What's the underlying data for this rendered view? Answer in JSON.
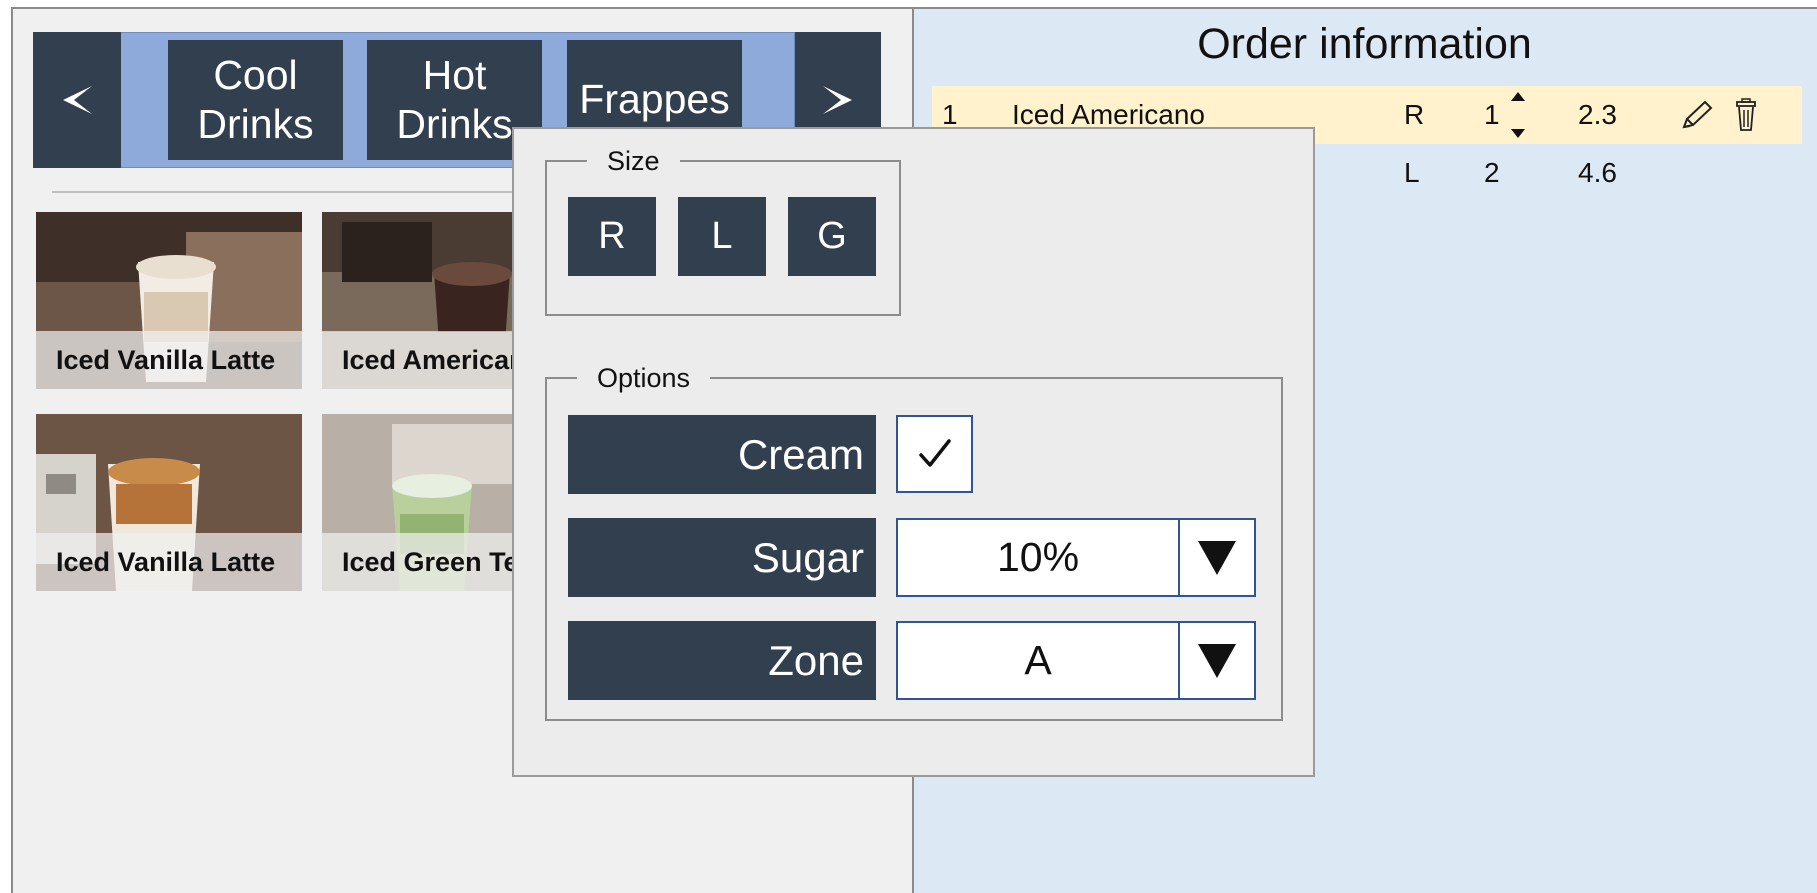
{
  "categories": {
    "prev_icon": "chevron-left-icon",
    "next_icon": "chevron-right-icon",
    "items": [
      {
        "label": "Cool\nDrinks"
      },
      {
        "label": "Hot\nDrinks"
      },
      {
        "label": "Frappes"
      }
    ]
  },
  "products": [
    {
      "name": "Iced Vanilla Latte"
    },
    {
      "name": "Iced Americano"
    },
    {
      "name": "Iced Vanilla Latte"
    },
    {
      "name": "Iced Green Tea"
    }
  ],
  "order": {
    "title": "Order information",
    "rows": [
      {
        "num": "1",
        "name": "Iced Americano",
        "size": "R",
        "qty": "1",
        "price": "2.3",
        "selected": true
      },
      {
        "num": "",
        "name": "",
        "size": "L",
        "qty": "2",
        "price": "4.6",
        "selected": false
      }
    ]
  },
  "dialog": {
    "size": {
      "legend": "Size",
      "options": [
        "R",
        "L",
        "G"
      ]
    },
    "options": {
      "legend": "Options",
      "cream_label": "Cream",
      "cream_checked": true,
      "sugar_label": "Sugar",
      "sugar_value": "10%",
      "zone_label": "Zone",
      "zone_value": "A"
    }
  },
  "colors": {
    "dark_button": "#323f4f",
    "category_strip": "#8eaadb",
    "order_panel": "#dde8f5",
    "selected_row": "#fff2cc",
    "select_border": "#2f5597"
  }
}
